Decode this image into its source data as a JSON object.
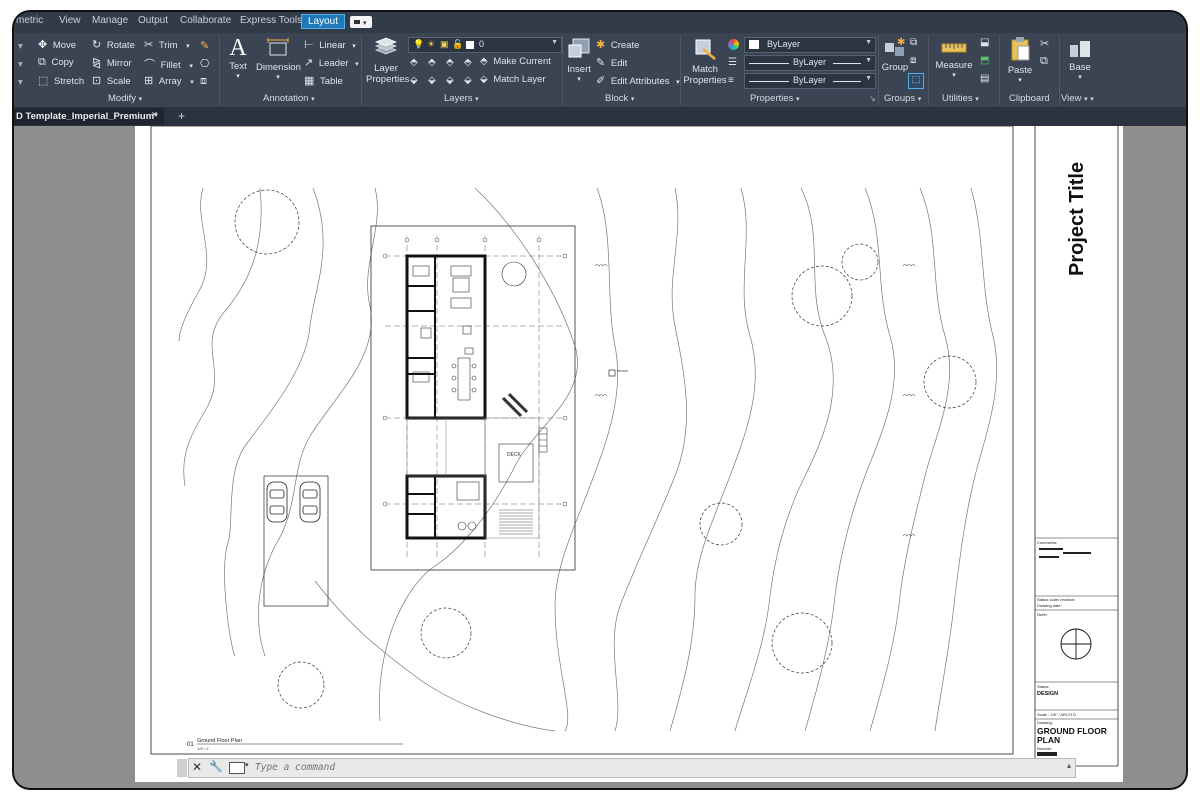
{
  "menu": {
    "tabs": [
      "metric",
      "View",
      "Manage",
      "Output",
      "Collaborate",
      "Express Tools",
      "Layout"
    ],
    "active_tab": "Layout"
  },
  "ribbon": {
    "modify": {
      "title": "Modify",
      "move": "Move",
      "rotate": "Rotate",
      "trim": "Trim",
      "copy": "Copy",
      "mirror": "Mirror",
      "fillet": "Fillet",
      "stretch": "Stretch",
      "scale": "Scale",
      "array": "Array"
    },
    "annotation": {
      "title": "Annotation",
      "text": "Text",
      "dimension": "Dimension",
      "linear": "Linear",
      "leader": "Leader",
      "table": "Table"
    },
    "layers": {
      "title": "Layers",
      "layer_properties_1": "Layer",
      "layer_properties_2": "Properties",
      "current_layer": "0",
      "make_current": "Make Current",
      "match_layer": "Match Layer"
    },
    "block": {
      "title": "Block",
      "insert": "Insert",
      "create": "Create",
      "edit": "Edit",
      "edit_attributes": "Edit Attributes"
    },
    "properties": {
      "title": "Properties",
      "match_1": "Match",
      "match_2": "Properties",
      "color": "ByLayer",
      "linetype": "ByLayer",
      "lineweight": "ByLayer"
    },
    "groups": {
      "title": "Groups",
      "group": "Group"
    },
    "utilities": {
      "title": "Utilities",
      "measure": "Measure"
    },
    "clipboard": {
      "title": "Clipboard",
      "paste": "Paste"
    },
    "view": {
      "title": "View",
      "base": "Base"
    }
  },
  "document": {
    "tab_title": "D Template_Imperial_Premium*",
    "close": "×",
    "new_tab": "+"
  },
  "sheet": {
    "project_title": "Project Title",
    "comments_label": "Comments:",
    "status_revision_label": "Status code/ revision:",
    "drawing_date_label": "Drawing date:",
    "north_label": "North",
    "status_label": "Status:",
    "status_value": "DESIGN",
    "scale_label": "Scale : 1/8\" / ARCH D",
    "drawing_label": "Drawing:",
    "drawing_title_1": "GROUND FLOOR",
    "drawing_title_2": "PLAN",
    "number_label": "Number:",
    "viewport_number": "01",
    "viewport_title": "Ground Floor Plan",
    "viewport_scale": "1/8\"=1'",
    "deck_label": "DECK"
  },
  "command": {
    "placeholder": "Type a command"
  },
  "colors": {
    "ribbon": "#3b4453",
    "active_tab": "#1f79b8",
    "canvas": "#8e8e8e"
  }
}
